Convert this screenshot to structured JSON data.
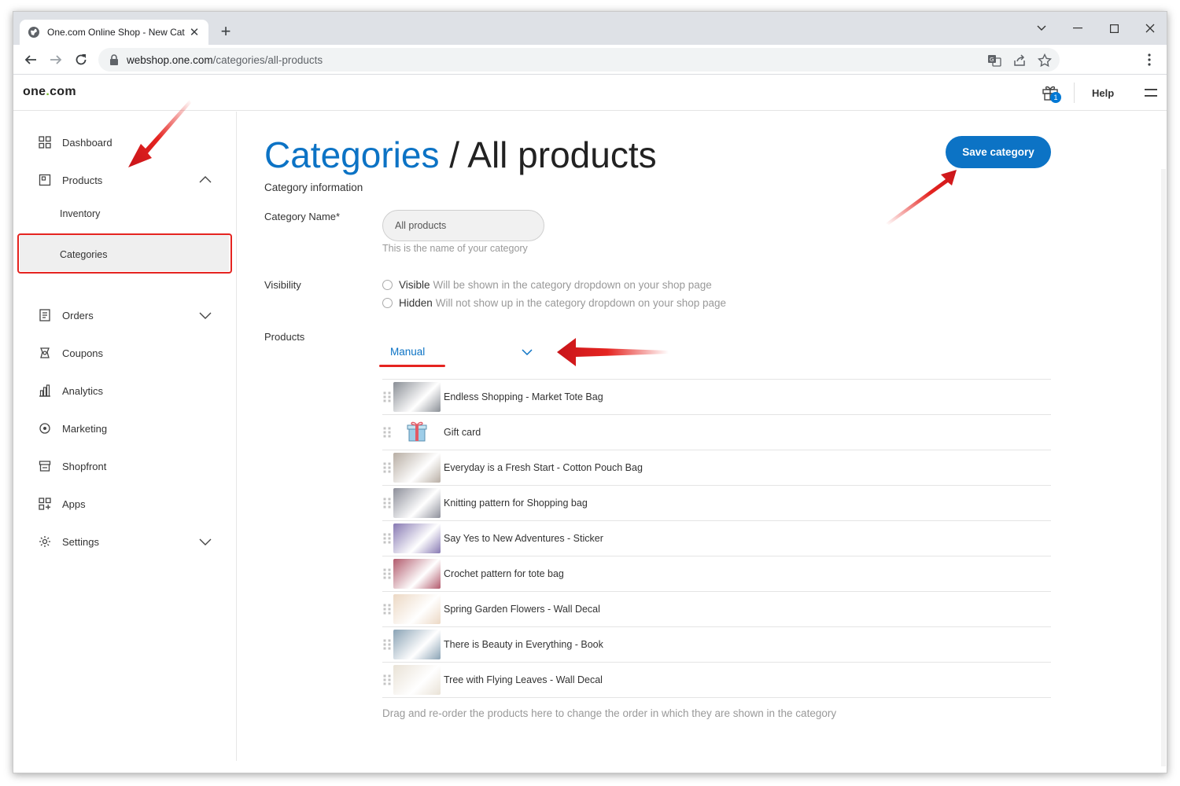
{
  "browser": {
    "tab_title": "One.com Online Shop - New Cat",
    "url_host": "webshop.one.com",
    "url_path": "/categories/all-products"
  },
  "header": {
    "logo_main": "one",
    "logo_dot": ".",
    "logo_tail": "com",
    "cart_badge": "1",
    "help": "Help"
  },
  "sidebar": {
    "dashboard": "Dashboard",
    "products": "Products",
    "inventory": "Inventory",
    "categories": "Categories",
    "orders": "Orders",
    "coupons": "Coupons",
    "analytics": "Analytics",
    "marketing": "Marketing",
    "shopfront": "Shopfront",
    "apps": "Apps",
    "settings": "Settings"
  },
  "main": {
    "title_crumb": "Categories",
    "title_sep": "/",
    "title_page": "All products",
    "section": "Category information",
    "save_button": "Save category",
    "name_label": "Category Name*",
    "name_value": "All products",
    "name_hint": "This is the name of your category",
    "visibility_label": "Visibility",
    "visible_option": "Visible",
    "visible_desc": "Will be shown in the category dropdown on your shop page",
    "hidden_option": "Hidden",
    "hidden_desc": "Will not show up in the category dropdown on your shop page",
    "products_label": "Products",
    "products_mode": "Manual",
    "footer_hint": "Drag and re-order the products here to change the order in which they are shown in the category"
  },
  "products": [
    {
      "name": "Endless Shopping - Market Tote Bag",
      "thumb_color": "#8a8f96"
    },
    {
      "name": "Gift card",
      "thumb_color": "#ffffff"
    },
    {
      "name": "Everyday is a Fresh Start - Cotton Pouch Bag",
      "thumb_color": "#b8aea4"
    },
    {
      "name": "Knitting pattern for Shopping bag",
      "thumb_color": "#8d8f9a"
    },
    {
      "name": "Say Yes to New Adventures - Sticker",
      "thumb_color": "#8779b3"
    },
    {
      "name": "Crochet pattern for tote bag",
      "thumb_color": "#b25b6d"
    },
    {
      "name": "Spring Garden Flowers - Wall Decal",
      "thumb_color": "#ecd8c4"
    },
    {
      "name": "There is Beauty in Everything - Book",
      "thumb_color": "#8aa3b5"
    },
    {
      "name": "Tree with Flying Leaves - Wall Decal",
      "thumb_color": "#e9e2d6"
    }
  ],
  "colors": {
    "accent": "#0c73c5",
    "annotation_red": "#e52420",
    "logo_green": "#76b82a"
  }
}
